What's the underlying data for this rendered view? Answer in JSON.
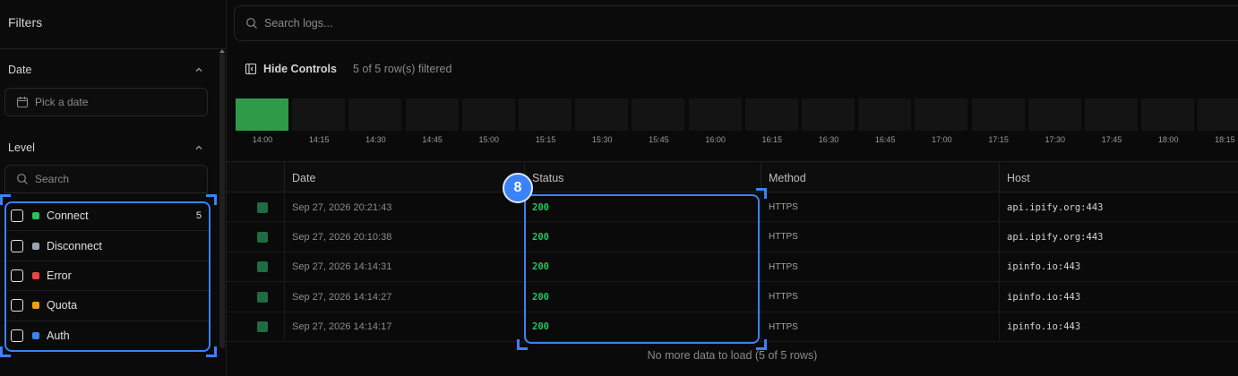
{
  "sidebar": {
    "title": "Filters",
    "date_section": {
      "label": "Date",
      "placeholder": "Pick a date"
    },
    "level_section": {
      "label": "Level",
      "search_placeholder": "Search",
      "items": [
        {
          "label": "Connect",
          "color": "#22c55e",
          "count": "5"
        },
        {
          "label": "Disconnect",
          "color": "#9ca3af",
          "count": ""
        },
        {
          "label": "Error",
          "color": "#ef4444",
          "count": ""
        },
        {
          "label": "Quota",
          "color": "#f59e0b",
          "count": ""
        },
        {
          "label": "Auth",
          "color": "#3b82f6",
          "count": ""
        }
      ]
    }
  },
  "search": {
    "placeholder": "Search logs..."
  },
  "controls": {
    "hide_label": "Hide Controls",
    "filtered_text": "5 of 5 row(s) filtered"
  },
  "timeline": {
    "ticks": [
      "14:00",
      "14:15",
      "14:30",
      "14:45",
      "15:00",
      "15:15",
      "15:30",
      "15:45",
      "16:00",
      "16:15",
      "16:30",
      "16:45",
      "17:00",
      "17:15",
      "17:30",
      "17:45",
      "18:00",
      "18:15"
    ],
    "active_index": 0
  },
  "table": {
    "columns": [
      "Date",
      "Status",
      "Method",
      "Host"
    ],
    "rows": [
      {
        "date": "Sep 27, 2026 20:21:43",
        "status": "200",
        "method": "HTTPS",
        "host": "api.ipify.org:443"
      },
      {
        "date": "Sep 27, 2026 20:10:38",
        "status": "200",
        "method": "HTTPS",
        "host": "api.ipify.org:443"
      },
      {
        "date": "Sep 27, 2026 14:14:31",
        "status": "200",
        "method": "HTTPS",
        "host": "ipinfo.io:443"
      },
      {
        "date": "Sep 27, 2026 14:14:27",
        "status": "200",
        "method": "HTTPS",
        "host": "ipinfo.io:443"
      },
      {
        "date": "Sep 27, 2026 14:14:17",
        "status": "200",
        "method": "HTTPS",
        "host": "ipinfo.io:443"
      }
    ],
    "footer": "No more data to load (5 of 5 rows)"
  },
  "annotation": {
    "badge": "8",
    "color": "#3b82f6"
  }
}
